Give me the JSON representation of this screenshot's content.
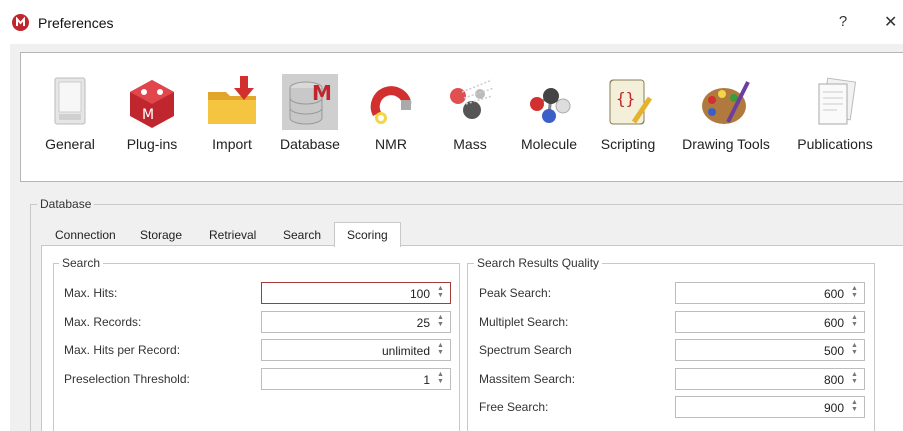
{
  "window": {
    "title": "Preferences",
    "help": "?",
    "close": "✕"
  },
  "toolbar": {
    "items": [
      {
        "label": "General",
        "icon": "general-icon"
      },
      {
        "label": "Plug-ins",
        "icon": "plugins-icon"
      },
      {
        "label": "Import",
        "icon": "import-icon"
      },
      {
        "label": "Database",
        "icon": "database-icon",
        "selected": true
      },
      {
        "label": "NMR",
        "icon": "nmr-icon"
      },
      {
        "label": "Mass",
        "icon": "mass-icon"
      },
      {
        "label": "Molecule",
        "icon": "molecule-icon"
      },
      {
        "label": "Scripting",
        "icon": "scripting-icon"
      },
      {
        "label": "Drawing Tools",
        "icon": "drawing-tools-icon"
      },
      {
        "label": "Publications",
        "icon": "publications-icon"
      }
    ]
  },
  "database_group": {
    "title": "Database"
  },
  "tabs": [
    {
      "label": "Connection"
    },
    {
      "label": "Storage"
    },
    {
      "label": "Retrieval"
    },
    {
      "label": "Search"
    },
    {
      "label": "Scoring",
      "active": true
    }
  ],
  "search_group": {
    "title": "Search",
    "rows": [
      {
        "label": "Max. Hits:",
        "value": "100"
      },
      {
        "label": "Max. Records:",
        "value": "25"
      },
      {
        "label": "Max. Hits per Record:",
        "value": "unlimited"
      },
      {
        "label": "Preselection Threshold:",
        "value": "1"
      }
    ]
  },
  "quality_group": {
    "title": "Search Results Quality",
    "rows": [
      {
        "label": "Peak Search:",
        "value": "600"
      },
      {
        "label": "Multiplet Search:",
        "value": "600"
      },
      {
        "label": "Spectrum Search",
        "value": "500"
      },
      {
        "label": "Massitem Search:",
        "value": "800"
      },
      {
        "label": "Free Search:",
        "value": "900"
      }
    ]
  },
  "colors": {
    "accent": "#c0262d",
    "focus_border": "#a53a3a",
    "selected_bg": "#cfcfcf"
  }
}
